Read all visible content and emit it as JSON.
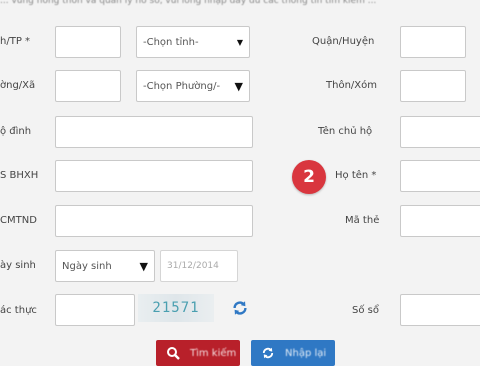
{
  "note": "... vùng nông thôn và quản lý hồ sơ, vui lòng nhập đầy đủ các thông tin tìm kiếm ...",
  "fields": {
    "province_label": "h/TP *",
    "province_select": "-Chọn tỉnh-",
    "district_label": "Quận/Huyện",
    "ward_label": "ờng/Xã",
    "ward_select": "-Chọn Phường/-",
    "hamlet_label": "Thôn/Xóm",
    "household_label": "ộ đình",
    "household_head_label": "Tên chủ hộ",
    "id_label": "S BHXH",
    "fullname_label": "Họ tên *",
    "idcard_label": "CMTND",
    "cardno_label": "Mã thẻ",
    "birth_label": "ày sinh",
    "birth_select": "Ngày sinh",
    "birth_date": "31/12/2014",
    "captcha_label": "ác thực",
    "captcha_code": "21571",
    "book_label": "Số sổ"
  },
  "badge": "2",
  "buttons": {
    "search": "Tìm kiếm",
    "reset": "Nhập lại"
  },
  "colors": {
    "badge": "#d9363e",
    "search_button": "#b8202a",
    "reset_button": "#2f78c4",
    "captcha_text": "#4a9fb0"
  },
  "icons": {
    "search_button": "search-icon",
    "reset_button": "refresh-icon",
    "captcha_refresh": "refresh-icon"
  }
}
